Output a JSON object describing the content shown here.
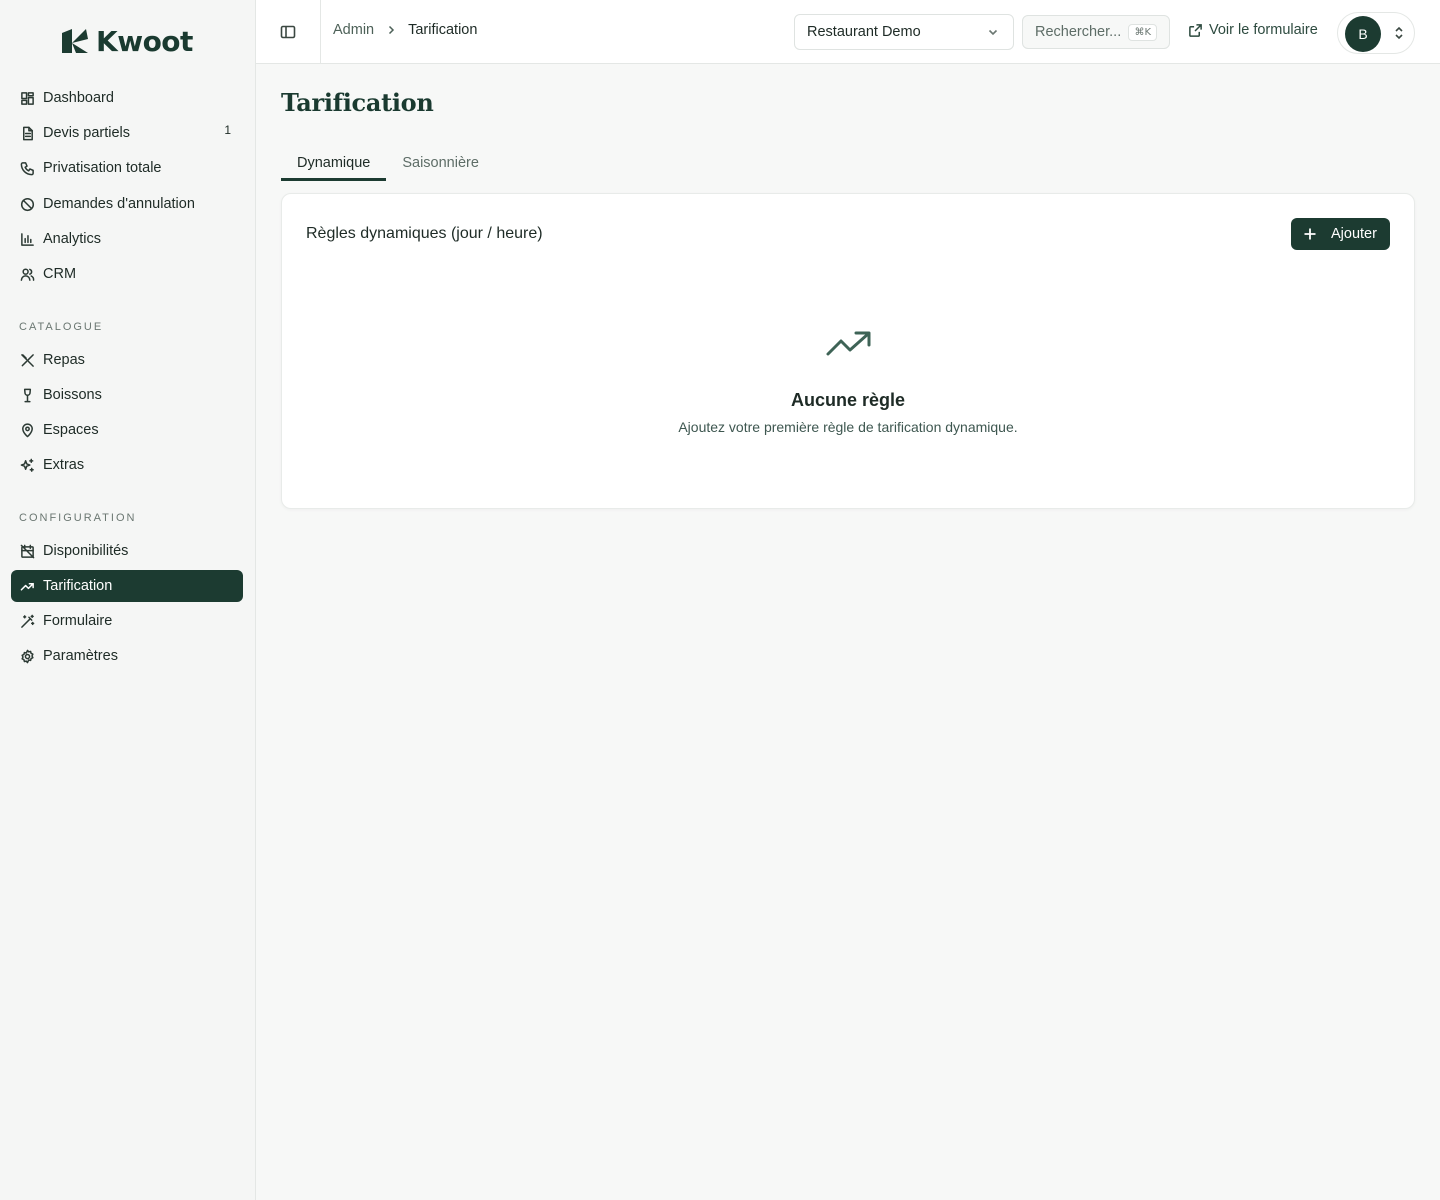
{
  "app": {
    "name": "Kwoot"
  },
  "sidebar": {
    "main_items": [
      {
        "label": "Dashboard",
        "icon": "dashboard-icon"
      },
      {
        "label": "Devis partiels",
        "icon": "document-icon",
        "badge": "1"
      },
      {
        "label": "Privatisation totale",
        "icon": "phone-icon"
      },
      {
        "label": "Demandes d'annulation",
        "icon": "ban-icon"
      },
      {
        "label": "Analytics",
        "icon": "bar-chart-icon"
      },
      {
        "label": "CRM",
        "icon": "users-icon"
      }
    ],
    "catalogue_label": "CATALOGUE",
    "catalogue_items": [
      {
        "label": "Repas",
        "icon": "utensils-icon"
      },
      {
        "label": "Boissons",
        "icon": "wine-icon"
      },
      {
        "label": "Espaces",
        "icon": "map-pin-icon"
      },
      {
        "label": "Extras",
        "icon": "sparkles-icon"
      }
    ],
    "configuration_label": "CONFIGURATION",
    "configuration_items": [
      {
        "label": "Disponibilités",
        "icon": "calendar-off-icon"
      },
      {
        "label": "Tarification",
        "icon": "trending-up-icon",
        "active": true
      },
      {
        "label": "Formulaire",
        "icon": "wand-icon"
      },
      {
        "label": "Paramètres",
        "icon": "gear-icon"
      }
    ]
  },
  "topbar": {
    "breadcrumb": {
      "parent": "Admin",
      "current": "Tarification"
    },
    "restaurant_select": "Restaurant Demo",
    "search_placeholder": "Rechercher...",
    "search_shortcut": "⌘K",
    "view_form_label": "Voir le formulaire",
    "user_initial": "B"
  },
  "main": {
    "title": "Tarification",
    "tabs": [
      {
        "label": "Dynamique",
        "active": true
      },
      {
        "label": "Saisonnière",
        "active": false
      }
    ],
    "card": {
      "title": "Règles dynamiques (jour / heure)",
      "add_label": "Ajouter",
      "empty_title": "Aucune règle",
      "empty_desc": "Ajoutez votre première règle de tarification dynamique."
    }
  },
  "colors": {
    "brand": "#1c3b31",
    "background": "#f7f8f7"
  }
}
